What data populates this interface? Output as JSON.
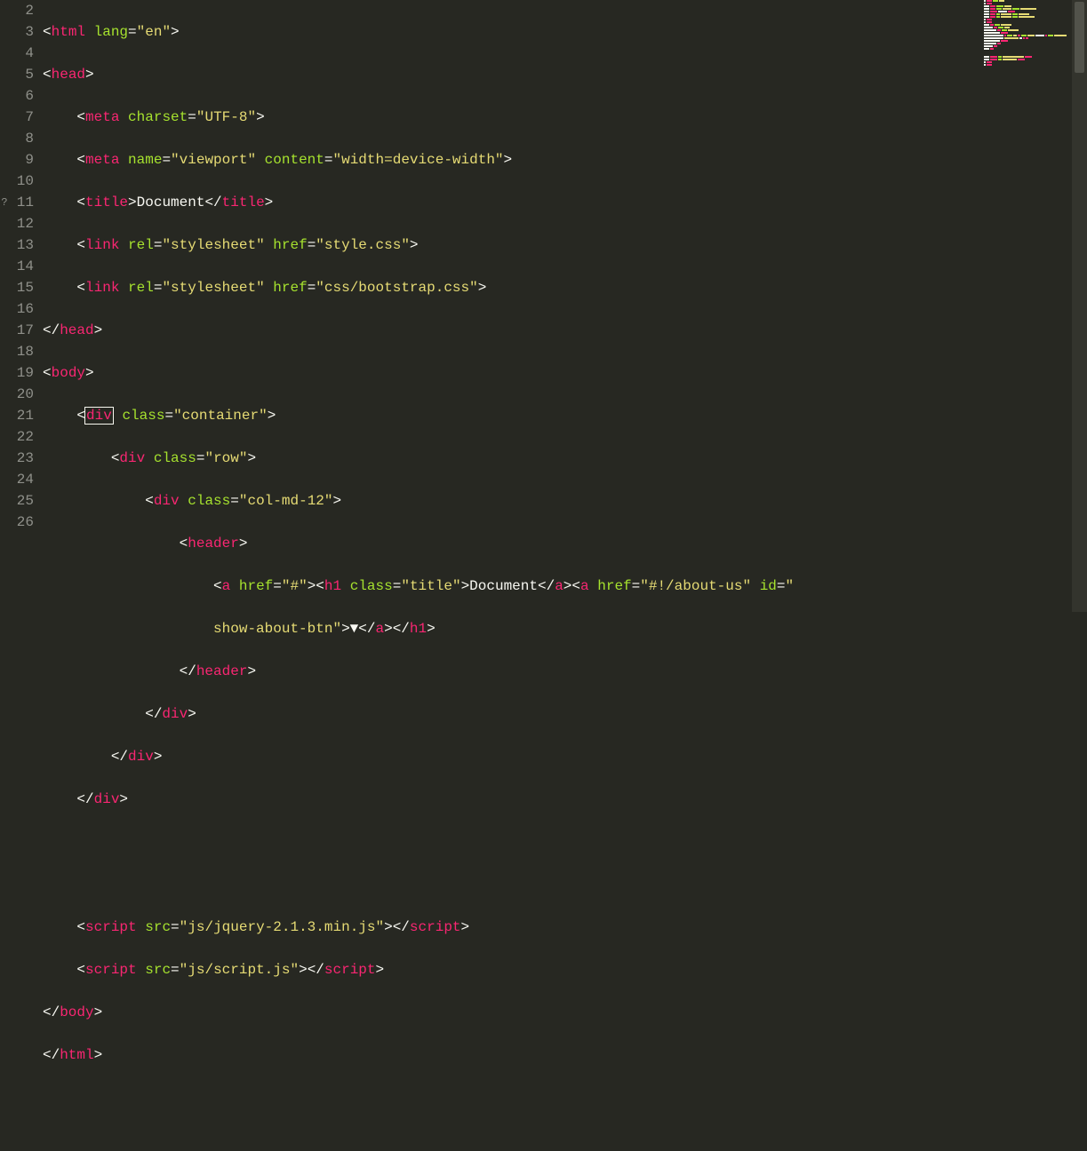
{
  "lineNumbers": [
    "2",
    "3",
    "4",
    "5",
    "6",
    "7",
    "8",
    "9",
    "10",
    "11",
    "12",
    "13",
    "14",
    "15",
    "16",
    "17",
    "18",
    "19",
    "20",
    "21",
    "22",
    "23",
    "24",
    "25",
    "26"
  ],
  "activeLineMarker": "?",
  "activeLine": 11,
  "code": {
    "l2": {
      "tag": "html",
      "attr": "lang",
      "val": "\"en\""
    },
    "l3": {
      "tag": "head"
    },
    "l4": {
      "tag": "meta",
      "attr": "charset",
      "val": "\"UTF-8\""
    },
    "l5": {
      "tag": "meta",
      "attr1": "name",
      "val1": "\"viewport\"",
      "attr2": "content",
      "val2": "\"width=device-width\""
    },
    "l6": {
      "tag": "title",
      "text": "Document",
      "ctag": "title"
    },
    "l7": {
      "tag": "link",
      "attr1": "rel",
      "val1": "\"stylesheet\"",
      "attr2": "href",
      "val2": "\"style.css\""
    },
    "l8": {
      "tag": "link",
      "attr1": "rel",
      "val1": "\"stylesheet\"",
      "attr2": "href",
      "val2": "\"css/bootstrap.css\""
    },
    "l9": {
      "ctag": "head"
    },
    "l10": {
      "tag": "body"
    },
    "l11": {
      "tag": "div",
      "attr": "class",
      "val": "\"container\""
    },
    "l12": {
      "tag": "div",
      "attr": "class",
      "val": "\"row\""
    },
    "l13": {
      "tag": "div",
      "attr": "class",
      "val": "\"col-md-12\""
    },
    "l14": {
      "tag": "header"
    },
    "l15a": {
      "tag1": "a",
      "attr1": "href",
      "val1": "\"#\"",
      "tag2": "h1",
      "attr2": "class",
      "val2": "\"title\"",
      "text1": "Document",
      "ctag1": "a",
      "tag3": "a",
      "attr3": "href",
      "val3": "\"#!/about-us\"",
      "attr4": "id",
      "val4": "\""
    },
    "l15b": {
      "val4b": "show-about-btn\"",
      "text2": "▼",
      "ctag2": "a",
      "ctag3": "h1"
    },
    "l16": {
      "ctag": "header"
    },
    "l17": {
      "ctag": "div"
    },
    "l18": {
      "ctag": "div"
    },
    "l19": {
      "ctag": "div"
    },
    "l22": {
      "tag": "script",
      "attr": "src",
      "val": "\"js/jquery-2.1.3.min.js\"",
      "ctag": "script"
    },
    "l23": {
      "tag": "script",
      "attr": "src",
      "val": "\"js/script.js\"",
      "ctag": "script"
    },
    "l24": {
      "ctag": "body"
    },
    "l25": {
      "ctag": "html"
    }
  },
  "punct": {
    "lt": "<",
    "gt": ">",
    "ltsl": "</",
    "eq": "=",
    "sp": " "
  }
}
